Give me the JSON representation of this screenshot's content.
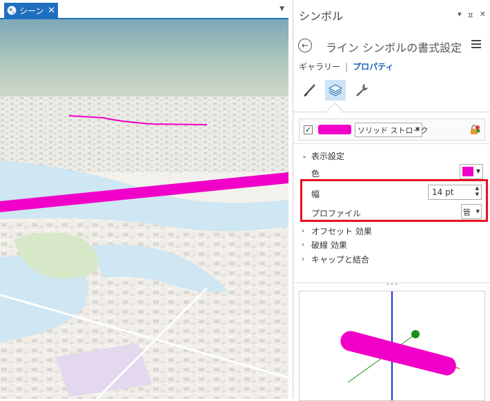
{
  "scene": {
    "tab_label": "シーン",
    "tab_close": "✕",
    "dropdown": "▼"
  },
  "pane": {
    "title": "シンボル",
    "tools": {
      "dropdown": "▾",
      "pin": "ㅍ",
      "close": "✕"
    },
    "heading": "ライン シンボルの書式設定",
    "tabs": {
      "gallery": "ギャラリー",
      "separator": "|",
      "properties": "プロパティ"
    },
    "layer": {
      "checked": "✓",
      "type": "ソリッド ストローク",
      "color": "#f000c8"
    },
    "sections": {
      "appearance": "表示設定",
      "offset": "オフセット 効果",
      "dash": "破線 効果",
      "caps": "キャップと結合"
    },
    "properties": {
      "color_label": "色",
      "color_value": "#f000c8",
      "width_label": "幅",
      "width_value": "14 pt",
      "profile_label": "プロファイル",
      "profile_value": "管"
    },
    "chevrons": {
      "open": "⌄",
      "closed": "›"
    }
  },
  "colors": {
    "accent": "#1f6fbf",
    "highlight": "#e8101f",
    "line": "#f000c8"
  }
}
